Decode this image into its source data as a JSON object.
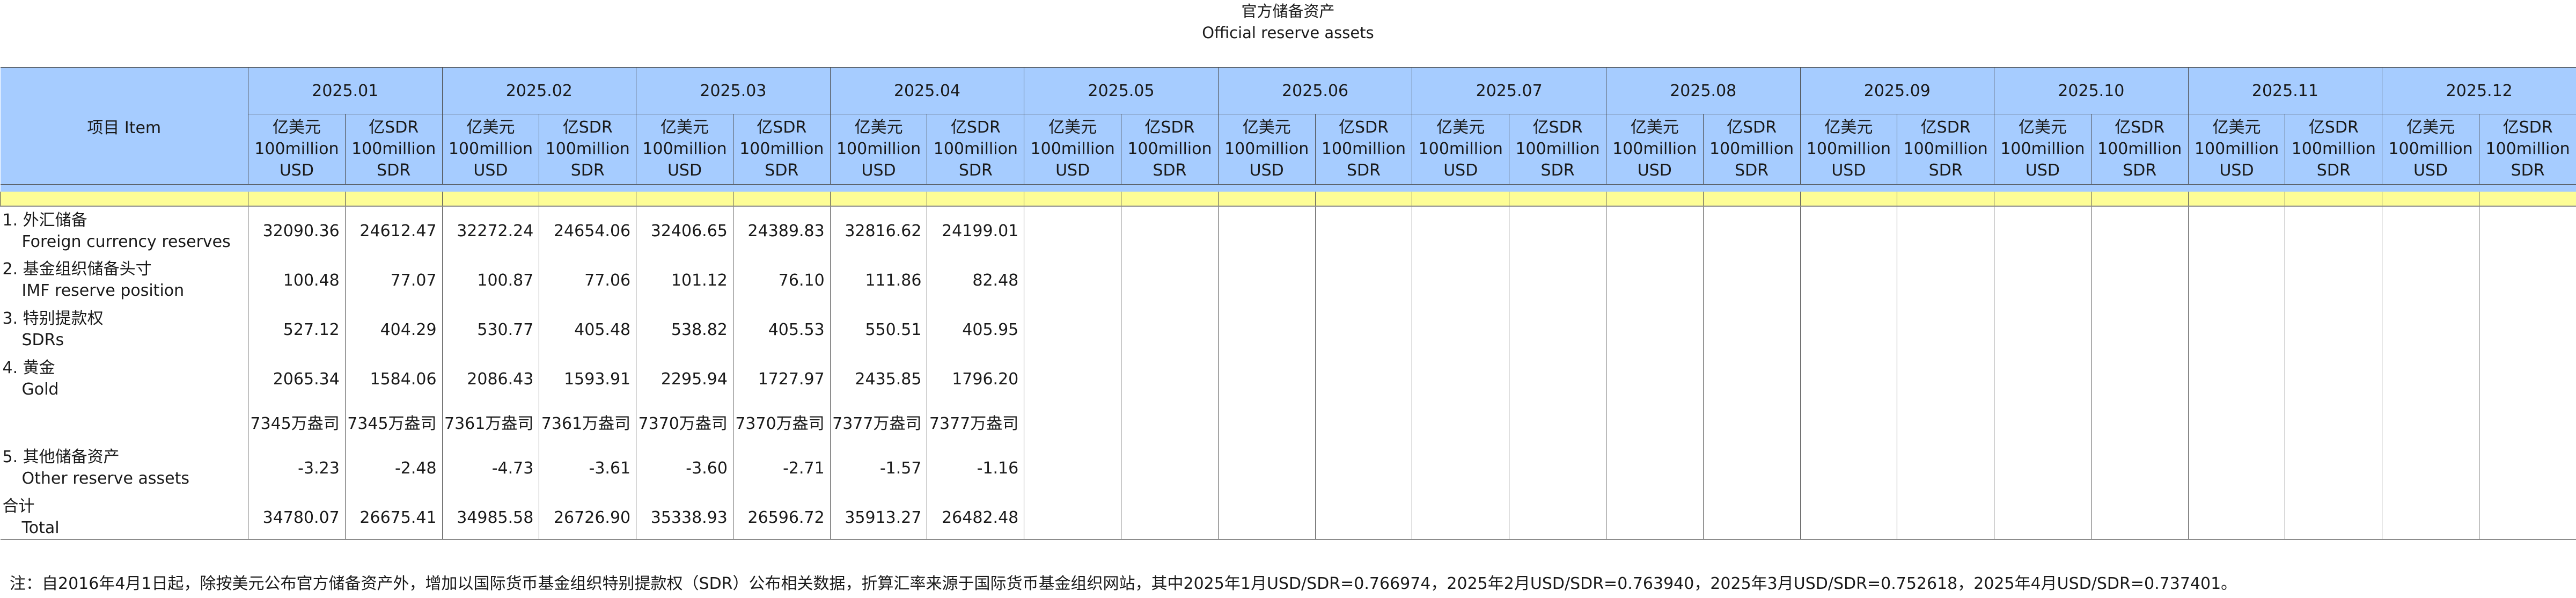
{
  "title_zh": "官方储备资产",
  "title_en": "Official reserve assets",
  "item_header": "项目  Item",
  "months": [
    "2025.01",
    "2025.02",
    "2025.03",
    "2025.04",
    "2025.05",
    "2025.06",
    "2025.07",
    "2025.08",
    "2025.09",
    "2025.10",
    "2025.11",
    "2025.12"
  ],
  "unit_usd": [
    "亿美元",
    "100million",
    "USD"
  ],
  "unit_sdr": [
    "亿SDR",
    "100million",
    "SDR"
  ],
  "rows": [
    {
      "zh": "1. 外汇储备",
      "en": "Foreign currency reserves",
      "values": [
        "32090.36",
        "24612.47",
        "32272.24",
        "24654.06",
        "32406.65",
        "24389.83",
        "32816.62",
        "24199.01",
        "",
        "",
        "",
        "",
        "",
        "",
        "",
        "",
        "",
        "",
        "",
        "",
        "",
        "",
        "",
        ""
      ]
    },
    {
      "zh": "2. 基金组织储备头寸",
      "en": "IMF reserve position",
      "values": [
        "100.48",
        "77.07",
        "100.87",
        "77.06",
        "101.12",
        "76.10",
        "111.86",
        "82.48",
        "",
        "",
        "",
        "",
        "",
        "",
        "",
        "",
        "",
        "",
        "",
        "",
        "",
        "",
        "",
        ""
      ]
    },
    {
      "zh": "3. 特别提款权",
      "en": "SDRs",
      "values": [
        "527.12",
        "404.29",
        "530.77",
        "405.48",
        "538.82",
        "405.53",
        "550.51",
        "405.95",
        "",
        "",
        "",
        "",
        "",
        "",
        "",
        "",
        "",
        "",
        "",
        "",
        "",
        "",
        "",
        ""
      ]
    },
    {
      "zh": "4. 黄金",
      "en": "Gold",
      "values": [
        "2065.34",
        "1584.06",
        "2086.43",
        "1593.91",
        "2295.94",
        "1727.97",
        "2435.85",
        "1796.20",
        "",
        "",
        "",
        "",
        "",
        "",
        "",
        "",
        "",
        "",
        "",
        "",
        "",
        "",
        "",
        ""
      ]
    },
    {
      "zh": "",
      "en": "",
      "values": [
        "7345万盎司",
        "7345万盎司",
        "7361万盎司",
        "7361万盎司",
        "7370万盎司",
        "7370万盎司",
        "7377万盎司",
        "7377万盎司",
        "",
        "",
        "",
        "",
        "",
        "",
        "",
        "",
        "",
        "",
        "",
        "",
        "",
        "",
        "",
        ""
      ]
    },
    {
      "zh": "5. 其他储备资产",
      "en": "Other reserve assets",
      "values": [
        "-3.23",
        "-2.48",
        "-4.73",
        "-3.61",
        "-3.60",
        "-2.71",
        "-1.57",
        "-1.16",
        "",
        "",
        "",
        "",
        "",
        "",
        "",
        "",
        "",
        "",
        "",
        "",
        "",
        "",
        "",
        ""
      ]
    },
    {
      "zh": "合计",
      "en": "Total",
      "values": [
        "34780.07",
        "26675.41",
        "34985.58",
        "26726.90",
        "35338.93",
        "26596.72",
        "35913.27",
        "26482.48",
        "",
        "",
        "",
        "",
        "",
        "",
        "",
        "",
        "",
        "",
        "",
        "",
        "",
        "",
        "",
        ""
      ]
    }
  ],
  "note": "注：自2016年4月1日起，除按美元公布官方储备资产外，增加以国际货币基金组织特别提款权（SDR）公布相关数据，折算汇率来源于国际货币基金组织网站，其中2025年1月USD/SDR=0.766974，2025年2月USD/SDR=0.763940，2025年3月USD/SDR=0.752618，2025年4月USD/SDR=0.737401。"
}
